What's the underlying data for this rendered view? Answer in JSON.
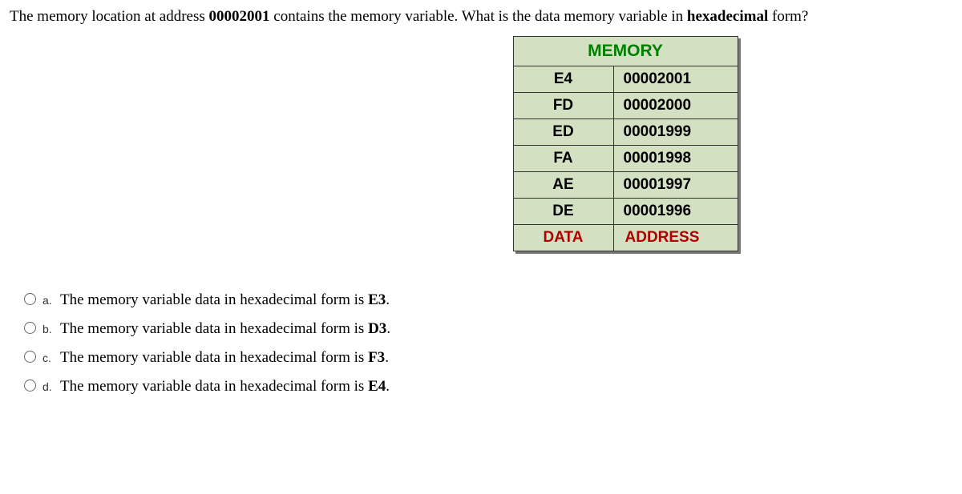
{
  "question": {
    "pre1": "The memory location at address ",
    "addr": "00002001",
    "mid": " contains the memory variable. What is the  data memory variable  in ",
    "hex": "hexadecimal",
    "post": " form?"
  },
  "table": {
    "header": "MEMORY",
    "rows": [
      {
        "data": "E4",
        "addr": "00002001"
      },
      {
        "data": "FD",
        "addr": "00002000"
      },
      {
        "data": "ED",
        "addr": "00001999"
      },
      {
        "data": "FA",
        "addr": "00001998"
      },
      {
        "data": "AE",
        "addr": "00001997"
      },
      {
        "data": "DE",
        "addr": "00001996"
      }
    ],
    "footer": {
      "data": "DATA",
      "addr": "ADDRESS"
    }
  },
  "options": [
    {
      "letter": "a.",
      "text": "The memory variable data in hexadecimal form is ",
      "ans": "E3",
      "tail": "."
    },
    {
      "letter": "b.",
      "text": "The memory variable data in hexadecimal form is ",
      "ans": "D3",
      "tail": "."
    },
    {
      "letter": "c.",
      "text": "The memory variable data in hexadecimal form is  ",
      "ans": "F3",
      "tail": "."
    },
    {
      "letter": "d.",
      "text": "The memory variable data in hexadecimal form is  ",
      "ans": "E4",
      "tail": "."
    }
  ]
}
